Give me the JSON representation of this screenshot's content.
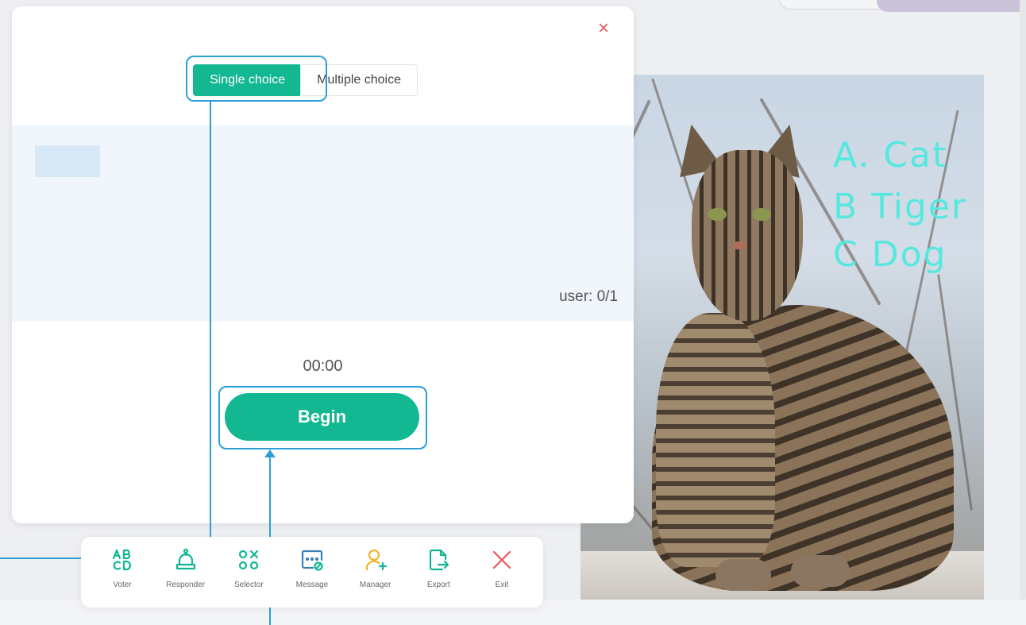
{
  "panel": {
    "close_symbol": "×",
    "tabs": [
      {
        "label": "Single choice",
        "active": true
      },
      {
        "label": "Multiple choice",
        "active": false
      }
    ],
    "user_count": "user: 0/1",
    "timer": "00:00",
    "begin_label": "Begin"
  },
  "photo_annotation": {
    "lines": [
      "A. Cat",
      "B Tiger",
      "C Dog"
    ]
  },
  "toolbar": {
    "items": [
      {
        "label": "Voter",
        "icon": "abcd-icon"
      },
      {
        "label": "Responder",
        "icon": "bell-icon"
      },
      {
        "label": "Selector",
        "icon": "selector-icon"
      },
      {
        "label": "Message",
        "icon": "message-icon"
      },
      {
        "label": "Manager",
        "icon": "manager-icon"
      },
      {
        "label": "Export",
        "icon": "export-icon"
      },
      {
        "label": "Exit",
        "icon": "exit-icon"
      }
    ]
  },
  "colors": {
    "accent": "#13b791",
    "highlight": "#2d9fd8",
    "close": "#e05a5a",
    "results_bg": "#f0f6fb",
    "icon_teal": "#12b694",
    "icon_blue": "#3a7fb5",
    "icon_yellow": "#f0b429",
    "icon_red": "#e8555a"
  }
}
